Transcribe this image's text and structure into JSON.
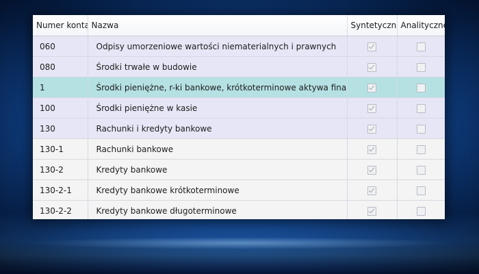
{
  "table": {
    "headers": {
      "account_number": "Numer konta",
      "name": "Nazwa",
      "synthetic": "Syntetyczne",
      "analytic": "Analityczne"
    },
    "rows": [
      {
        "account_number": "060",
        "name": "Odpisy umorzeniowe wartości niematerialnych i prawnych",
        "synthetic": true,
        "analytic": false,
        "style": "synthetic"
      },
      {
        "account_number": "080",
        "name": "Środki trwałe w budowie",
        "synthetic": true,
        "analytic": false,
        "style": "synthetic"
      },
      {
        "account_number": "1",
        "name": "Środki pieniężne, r-ki bankowe, krótkoterminowe aktywa finansowe",
        "synthetic": true,
        "analytic": false,
        "style": "selected"
      },
      {
        "account_number": "100",
        "name": "Środki pieniężne w kasie",
        "synthetic": true,
        "analytic": false,
        "style": "synthetic"
      },
      {
        "account_number": "130",
        "name": "Rachunki i kredyty bankowe",
        "synthetic": true,
        "analytic": false,
        "style": "synthetic"
      },
      {
        "account_number": "130-1",
        "name": "Rachunki bankowe",
        "synthetic": true,
        "analytic": false,
        "style": "analytic"
      },
      {
        "account_number": "130-2",
        "name": "Kredyty bankowe",
        "synthetic": true,
        "analytic": false,
        "style": "analytic"
      },
      {
        "account_number": "130-2-1",
        "name": "Kredyty bankowe krótkoterminowe",
        "synthetic": true,
        "analytic": false,
        "style": "analytic"
      },
      {
        "account_number": "130-2-2",
        "name": "Kredyty bankowe długoterminowe",
        "synthetic": true,
        "analytic": false,
        "style": "analytic"
      }
    ]
  },
  "colors": {
    "synthetic_row": "#e6e6f6",
    "analytic_row": "#f4f4f4",
    "selected_row": "#b5e1e3",
    "background": "#0f3f82"
  }
}
